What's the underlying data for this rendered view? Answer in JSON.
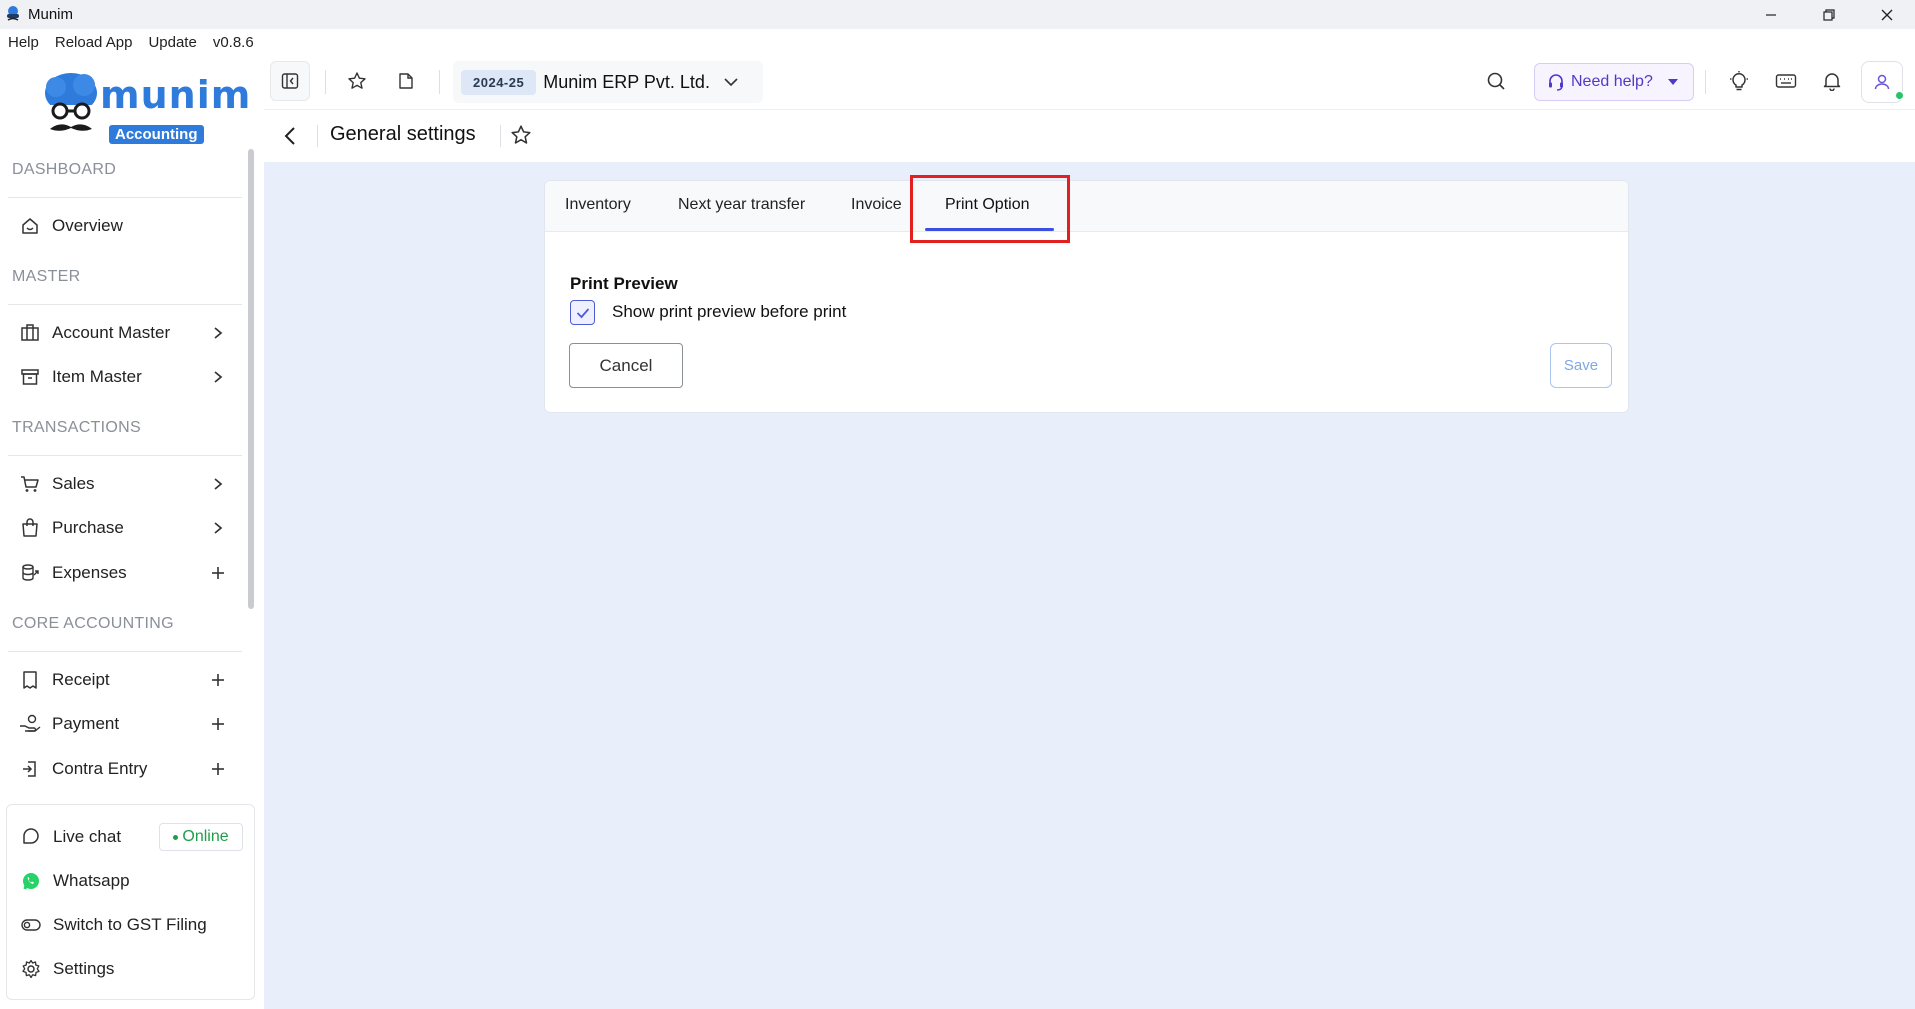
{
  "window": {
    "title": "Munim",
    "controls": [
      "minimize-icon",
      "restore-icon",
      "close-icon"
    ]
  },
  "menubar": {
    "items": [
      "Help",
      "Reload App",
      "Update",
      "v0.8.6"
    ]
  },
  "logo": {
    "word": "munim",
    "badge": "Accounting"
  },
  "sidebar": {
    "sections": {
      "dashboard": "DASHBOARD",
      "master": "MASTER",
      "transactions": "TRANSACTIONS",
      "core": "CORE ACCOUNTING"
    },
    "items": {
      "overview": {
        "label": "Overview",
        "icon": "home-icon"
      },
      "account_master": {
        "label": "Account Master",
        "icon": "building-icon",
        "tail": "chevron-right-icon"
      },
      "item_master": {
        "label": "Item Master",
        "icon": "box-icon",
        "tail": "chevron-right-icon"
      },
      "sales": {
        "label": "Sales",
        "icon": "cart-icon",
        "tail": "chevron-right-icon"
      },
      "purchase": {
        "label": "Purchase",
        "icon": "bag-icon",
        "tail": "chevron-right-icon"
      },
      "expenses": {
        "label": "Expenses",
        "icon": "expenses-icon",
        "tail": "plus-icon"
      },
      "receipt": {
        "label": "Receipt",
        "icon": "receipt-icon",
        "tail": "plus-icon"
      },
      "payment": {
        "label": "Payment",
        "icon": "payment-icon",
        "tail": "plus-icon"
      },
      "contra_entry": {
        "label": "Contra Entry",
        "icon": "contra-icon",
        "tail": "plus-icon"
      }
    },
    "bottom": {
      "live_chat": "Live chat",
      "online": "Online",
      "whatsapp": "Whatsapp",
      "switch_gst": "Switch to GST Filing",
      "settings": "Settings"
    }
  },
  "topbar": {
    "year": "2024-25",
    "company": "Munim ERP Pvt. Ltd.",
    "help_label": "Need help?"
  },
  "page": {
    "title": "General settings"
  },
  "tabs": [
    "Inventory",
    "Next year transfer",
    "Invoice",
    "Print Option"
  ],
  "active_tab": "Print Option",
  "print_preview": {
    "title": "Print Preview",
    "checkbox_label": "Show print preview before print",
    "checked": true
  },
  "actions": {
    "cancel": "Cancel",
    "save": "Save"
  },
  "colors": {
    "brand_blue": "#2f7bdc",
    "tab_underline": "#3b4fe0",
    "highlight_red": "#e32020",
    "online_green": "#1e9e4a",
    "content_bg": "#e9eefb"
  }
}
